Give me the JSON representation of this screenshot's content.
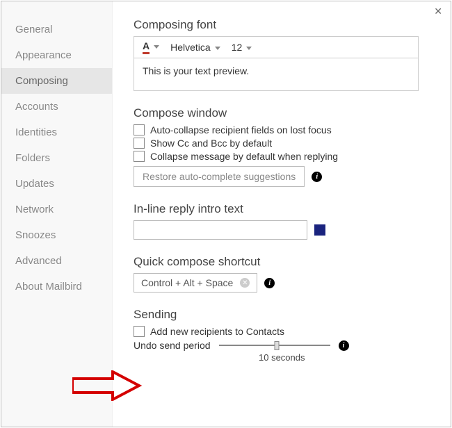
{
  "sidebar": {
    "items": [
      {
        "label": "General"
      },
      {
        "label": "Appearance"
      },
      {
        "label": "Composing",
        "active": true
      },
      {
        "label": "Accounts"
      },
      {
        "label": "Identities"
      },
      {
        "label": "Folders"
      },
      {
        "label": "Updates"
      },
      {
        "label": "Network"
      },
      {
        "label": "Snoozes"
      },
      {
        "label": "Advanced"
      },
      {
        "label": "About Mailbird"
      }
    ]
  },
  "sections": {
    "font": {
      "title": "Composing font",
      "color_letter": "A",
      "font_name": "Helvetica",
      "font_size": "12",
      "preview": "This is your text preview."
    },
    "compose_window": {
      "title": "Compose window",
      "opts": [
        "Auto-collapse recipient fields on lost focus",
        "Show Cc and Bcc by default",
        "Collapse message by default when replying"
      ],
      "restore_btn": "Restore auto-complete suggestions"
    },
    "inline_reply": {
      "title": "In-line reply intro text",
      "value": ""
    },
    "quick_compose": {
      "title": "Quick compose shortcut",
      "shortcut": "Control + Alt + Space"
    },
    "sending": {
      "title": "Sending",
      "add_contacts": "Add new recipients to Contacts",
      "undo_label": "Undo send period",
      "undo_caption": "10 seconds"
    }
  }
}
